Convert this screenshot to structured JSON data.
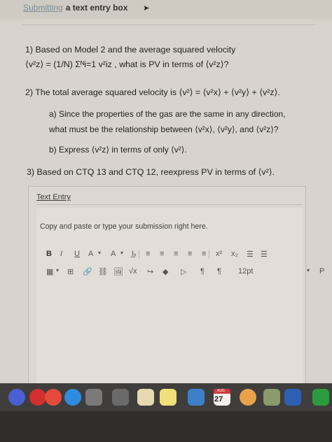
{
  "header": {
    "title_link": "Submitting",
    "title_rest": "a text entry box"
  },
  "questions": {
    "q1_line1": "1) Based on Model 2 and the average squared velocity",
    "q1_line2": "⟨v²z⟩ = (1/N) Σᴺi=1 v²iz , what is PV in terms of ⟨v²z⟩?",
    "q2": "2) The total average squared velocity is ⟨v²⟩ = ⟨v²x⟩ + ⟨v²y⟩ + ⟨v²z⟩.",
    "q2a_line1": "a) Since the properties of the gas are the same in any direction,",
    "q2a_line2": "what must be the relationship between ⟨v²x⟩, ⟨v²y⟩, and ⟨v²z⟩?",
    "q2b": "b) Express ⟨v²z⟩ in terms of only ⟨v²⟩.",
    "q3": "3) Based on CTQ 13 and CTQ 12, reexpress PV in terms of ⟨v²⟩."
  },
  "editor": {
    "tab_label": "Text Entry",
    "instruction": "Copy and paste or type your submission right here.",
    "toolbar_row1": [
      "B",
      "I",
      "U",
      "A",
      "▾",
      "A",
      "▾",
      "I̲ₓ",
      "≡",
      "≡",
      "≡",
      "≡",
      "≡",
      "x²",
      "x₂",
      "☰",
      "☰"
    ],
    "toolbar_row2": [
      "▦",
      "▾",
      "⊞",
      "🔗",
      "⛓",
      "🖼",
      "√x",
      "↪",
      "◆",
      "▷",
      "¶",
      "¶",
      "12pt",
      "▾",
      "P"
    ]
  },
  "dock": {
    "calendar_month": "AUG",
    "calendar_day": "27"
  },
  "colors": {
    "screen_bg": "#d8d4cd",
    "link": "#7b8e98",
    "dock": "#3f3e3c"
  }
}
